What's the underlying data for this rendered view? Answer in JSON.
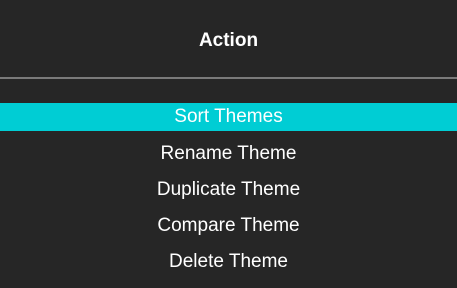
{
  "dialog": {
    "title": "Action",
    "colors": {
      "background": "#262626",
      "divider": "#7a7a7a",
      "selected_highlight": "#00cdd4",
      "text": "#ffffff"
    }
  },
  "menu": {
    "selected_index": 0,
    "items": [
      {
        "label": "Sort Themes"
      },
      {
        "label": "Rename Theme"
      },
      {
        "label": "Duplicate Theme"
      },
      {
        "label": "Compare Theme"
      },
      {
        "label": "Delete Theme"
      }
    ]
  }
}
